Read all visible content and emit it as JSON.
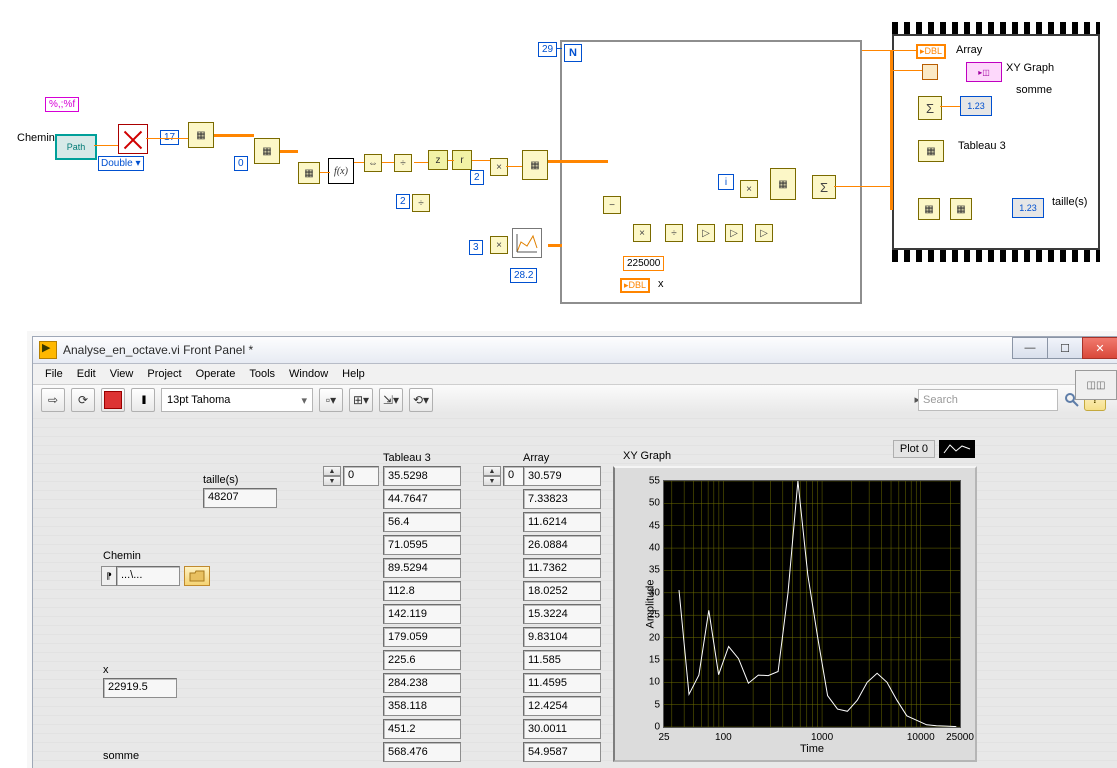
{
  "bd": {
    "chemin_label": "Chemin",
    "path_caption": "Path",
    "format_str": "%,;%f",
    "double_ring": "Double",
    "const_17": "17",
    "const_0": "0",
    "const_2a": "2",
    "const_2b": "2",
    "const_3": "3",
    "const_28_2": "28.2",
    "const_225000": "225000",
    "const_29": "29",
    "label_x": "x",
    "seq_labels": {
      "array": "Array",
      "xy_graph": "XY Graph",
      "somme": "somme",
      "tableau3": "Tableau 3",
      "taille": "taille(s)"
    },
    "dbl_tag": "DBL",
    "num_ind": "1.23"
  },
  "window": {
    "title": "Analyse_en_octave.vi Front Panel *",
    "min": "—",
    "max": "☐",
    "close": "✕"
  },
  "menu": [
    "File",
    "Edit",
    "View",
    "Project",
    "Operate",
    "Tools",
    "Window",
    "Help"
  ],
  "toolbar": {
    "font": "13pt Tahoma",
    "search_ph": "Search",
    "help": "?"
  },
  "labels": {
    "taille": "taille(s)",
    "chemin": "Chemin",
    "x": "x",
    "somme": "somme",
    "tableau3": "Tableau 3",
    "array": "Array",
    "xy_graph": "XY Graph"
  },
  "values": {
    "taille": "48207",
    "path_value": "...\\...",
    "x": "22919.5",
    "index0_a": "0",
    "index0_b": "0"
  },
  "tableau3": [
    "35.5298",
    "44.7647",
    "56.4",
    "71.0595",
    "89.5294",
    "112.8",
    "142.119",
    "179.059",
    "225.6",
    "284.238",
    "358.118",
    "451.2",
    "568.476"
  ],
  "array": [
    "30.579",
    "7.33823",
    "11.6214",
    "26.0884",
    "11.7362",
    "18.0252",
    "15.3224",
    "9.83104",
    "11.585",
    "11.4595",
    "12.4254",
    "30.0011",
    "54.9587"
  ],
  "chart": {
    "title": "XY Graph",
    "ylabel": "Amplitude",
    "xlabel": "Time",
    "yticks": [
      0,
      5,
      10,
      15,
      20,
      25,
      30,
      35,
      40,
      45,
      50,
      55
    ],
    "xticks": [
      25,
      100,
      1000,
      10000,
      25000
    ],
    "legend": "Plot 0"
  },
  "chart_data": {
    "type": "line",
    "title": "XY Graph",
    "xlabel": "Time",
    "ylabel": "Amplitude",
    "x_scale": "log",
    "xlim": [
      25,
      25000
    ],
    "ylim": [
      0,
      55
    ],
    "series": [
      {
        "name": "Plot 0",
        "x": [
          35.5,
          44.8,
          56.4,
          71.1,
          89.5,
          112.8,
          142.1,
          179.1,
          225.6,
          284.2,
          358.1,
          451.2,
          568.5,
          716.2,
          902.4,
          1137,
          1432,
          1805,
          2275,
          2866,
          3612,
          4551,
          5735,
          7225,
          9103,
          11470,
          14449,
          18205,
          22937
        ],
        "y": [
          30.6,
          7.3,
          11.6,
          26.1,
          11.7,
          18.0,
          15.3,
          9.8,
          11.6,
          11.5,
          12.4,
          30.0,
          55.0,
          34.0,
          20.0,
          7.0,
          4.0,
          3.5,
          6.0,
          10.0,
          12.0,
          10.0,
          6.0,
          2.5,
          1.5,
          0.5,
          0.3,
          0.2,
          0.1
        ]
      }
    ]
  }
}
